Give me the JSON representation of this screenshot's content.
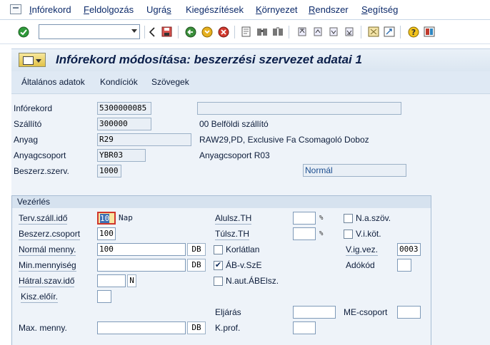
{
  "menu": {
    "items": [
      {
        "pre": "",
        "u": "I",
        "post": "nfórekord"
      },
      {
        "pre": "",
        "u": "F",
        "post": "eldolgozás"
      },
      {
        "pre": "Ugrá",
        "u": "s",
        "post": ""
      },
      {
        "pre": "Kie",
        "u": "g",
        "post": "észítések"
      },
      {
        "pre": "",
        "u": "K",
        "post": "örnyezet"
      },
      {
        "pre": "",
        "u": "R",
        "post": "endszer"
      },
      {
        "pre": "",
        "u": "S",
        "post": "egítség"
      }
    ]
  },
  "toolbar": {
    "command_value": ""
  },
  "title": "Infórekord módosítása: beszerzési szervezet adatai 1",
  "app_toolbar": {
    "general": "Általános adatok",
    "conditions": "Kondíciók",
    "texts": "Szövegek"
  },
  "header": {
    "inforecord_label": "Infórekord",
    "inforecord_value": "5300000085",
    "inforecord_desc": "",
    "vendor_label": "Szállító",
    "vendor_value": "300000",
    "vendor_desc": "00 Belföldi szállító",
    "material_label": "Anyag",
    "material_value": "R29",
    "material_desc": "RAW29,PD, Exclusive Fa Csomagoló Doboz",
    "matgroup_label": "Anyagcsoport",
    "matgroup_value": "YBR03",
    "matgroup_desc": "Anyagcsoport  R03",
    "purchorg_label": "Beszerz.szerv.",
    "purchorg_value": "1000",
    "category_value": "Normál"
  },
  "control": {
    "group_title": "Vezérlés",
    "plan_delivery_label": "Terv.száll.idő",
    "plan_delivery_value": "10",
    "plan_delivery_unit": "Nap",
    "purch_group_label": "Beszerz.csoport",
    "purch_group_value": "100",
    "std_qty_label": "Normál menny.",
    "std_qty_value": "100",
    "std_qty_unit": "DB",
    "min_qty_label": "Min.mennyiség",
    "min_qty_value": "",
    "min_qty_unit": "DB",
    "rem_shelf_label": "Hátral.szav.idő",
    "rem_shelf_value": "",
    "rem_shelf_unit": "N",
    "pack_label": "Kisz.előír.",
    "pack_value": "",
    "max_qty_label": "Max. menny.",
    "max_qty_value": "",
    "max_qty_unit": "DB",
    "under_tol_label": "Alulsz.TH",
    "under_tol_value": "",
    "pct1": "%",
    "over_tol_label": "Túlsz.TH",
    "over_tol_value": "",
    "pct2": "%",
    "unlimited_label": "Korlátlan",
    "unlimited_checked": false,
    "gr_based_label": "ÁB-v.SzE",
    "gr_based_checked": true,
    "no_auto_label": "N.aut.ÁBElsz.",
    "no_auto_checked": false,
    "procedure_label": "Eljárás",
    "procedure_value": "",
    "cprof_label": "K.prof.",
    "cprof_value": "",
    "no_text_label": "N.a.szöv.",
    "no_text_checked": false,
    "ack_label": "V.i.köt.",
    "ack_checked": false,
    "conf_ctrl_label": "V.ig.vez.",
    "conf_ctrl_value": "0003",
    "tax_label": "Adókód",
    "tax_value": "",
    "qty_group_label": "ME-csoport",
    "qty_group_value": ""
  },
  "colors": {
    "menu_text": "#0c2a6a",
    "title_bar": "#dbe6f1",
    "content_bg": "#eef3f9",
    "field_border": "#7f9ab8",
    "focus_field": "#e8c43a"
  },
  "icons": [
    "check-icon",
    "back-nav-icon",
    "save-icon",
    "back-icon",
    "exit-icon",
    "cancel-icon",
    "print-icon",
    "find-icon",
    "find-next-icon",
    "first-page-icon",
    "prev-page-icon",
    "next-page-icon",
    "last-page-icon",
    "new-session-icon",
    "shortcut-icon",
    "help-icon",
    "layout-icon"
  ]
}
